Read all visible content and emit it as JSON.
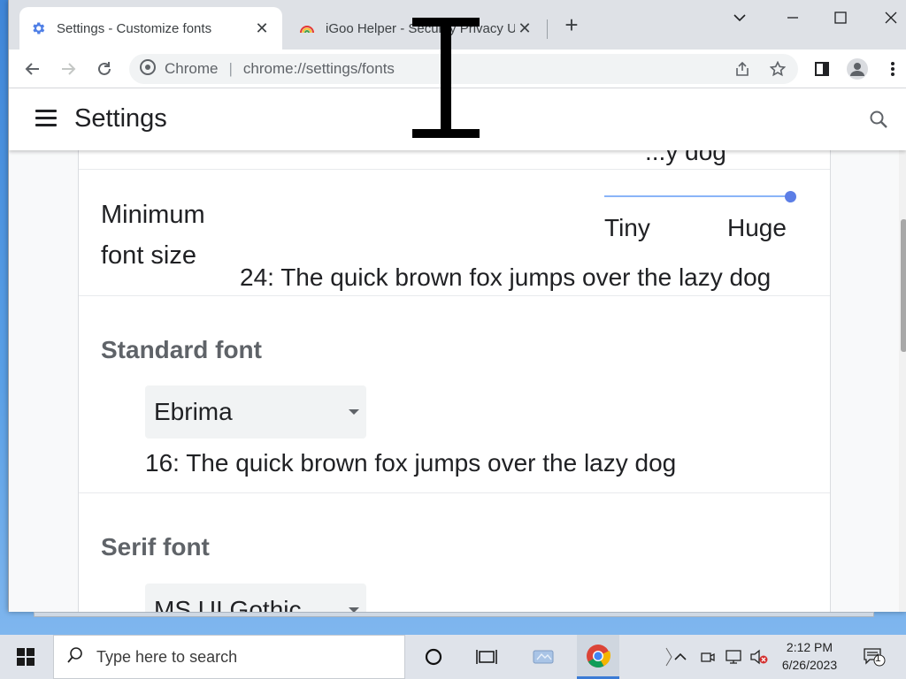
{
  "tabs": [
    {
      "title": "Settings - Customize fonts",
      "close": "✕",
      "active": true,
      "favicon": "gear-icon"
    },
    {
      "title": "iGoo Helper - Security Privacy Unblock VPN",
      "close": "✕",
      "active": false,
      "favicon": "rainbow-icon"
    }
  ],
  "new_tab": "+",
  "omnibox": {
    "chrome_label": "Chrome",
    "separator": "|",
    "url": "chrome://settings/fonts"
  },
  "settings": {
    "title": "Settings"
  },
  "prev_row_tail": "...y dog",
  "minimum_font": {
    "label": "Minimum font size",
    "slider_min_label": "Tiny",
    "slider_max_label": "Huge",
    "slider_value_fraction": 1.0,
    "preview": "24: The quick brown fox jumps over the lazy dog"
  },
  "standard_font": {
    "heading": "Standard font",
    "selected": "Ebrima",
    "preview": "16: The quick brown fox jumps over the lazy dog"
  },
  "serif_font": {
    "heading": "Serif font",
    "selected": "MS UI Gothic"
  },
  "taskbar": {
    "search_placeholder": "Type here to search",
    "time": "2:12 PM",
    "date": "6/26/2023",
    "notification_count": "1"
  },
  "colors": {
    "accent": "#1a73e8",
    "slider": "#5c7ee6",
    "heading_gray": "#5f6368"
  }
}
